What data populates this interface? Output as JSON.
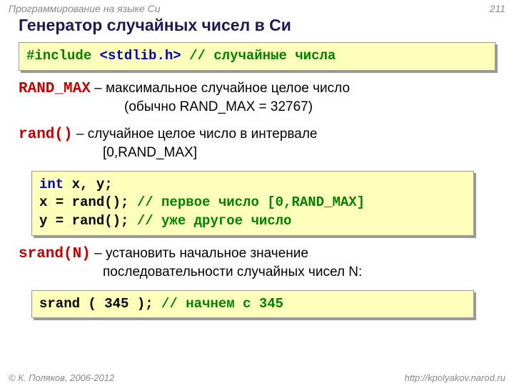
{
  "header": {
    "course": "Программирование на языке Си",
    "page": "211"
  },
  "title": "Генератор случайных чисел в Си",
  "inc": {
    "directive": "#include ",
    "hdr": "<stdlib.h>",
    "space": "    ",
    "comment": "// случайные числа"
  },
  "randmax": {
    "kw": "RAND_MAX",
    "desc": " – максимальное случайное целое число",
    "sub": "(обычно RAND_MAX = 32767)"
  },
  "rand": {
    "kw": "rand()",
    "desc": "  – случайное целое число в интервале",
    "sub": "[0,RAND_MAX]"
  },
  "code2": {
    "l1a": "int",
    "l1b": " x, y;",
    "l2a": "x = rand(); ",
    "l2c": "// первое число [0,RAND_MAX]",
    "l3a": "y = rand(); ",
    "l3c": "// уже другое число"
  },
  "srand": {
    "kw": "srand(N)",
    "desc": " – установить начальное значение",
    "sub": "последовательности случайных чисел N:"
  },
  "code3": {
    "a": "srand ( 345 ); ",
    "c": "// начнем с 345"
  },
  "footer": {
    "copy": "© К. Поляков, 2006-2012",
    "url": "http://kpolyakov.narod.ru"
  }
}
